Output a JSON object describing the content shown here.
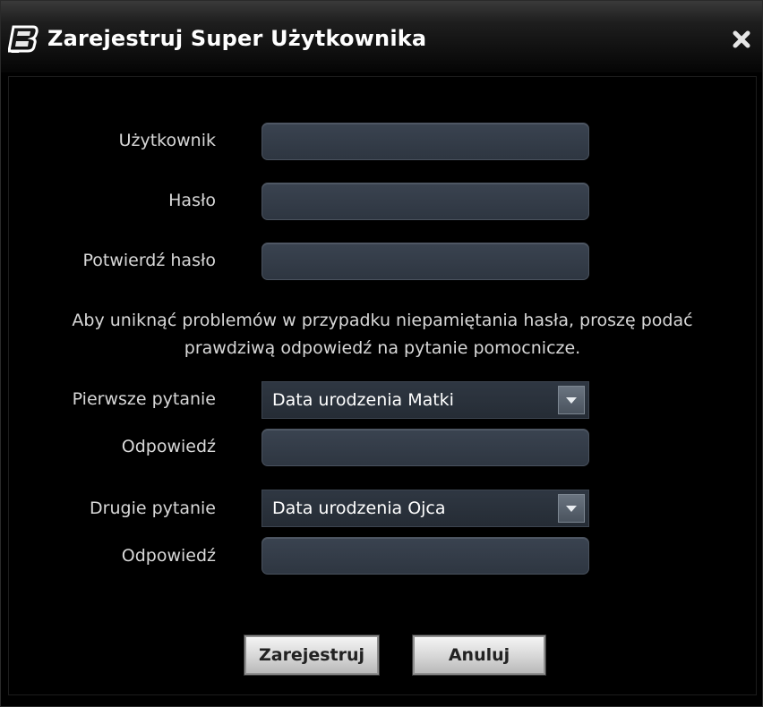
{
  "window": {
    "title": "Zarejestruj Super Użytkownika",
    "logo_icon": "b-logo-icon",
    "close_icon": "close-icon"
  },
  "form": {
    "username_label": "Użytkownik",
    "username_value": "",
    "password_label": "Hasło",
    "password_value": "",
    "confirm_label": "Potwierdź hasło",
    "confirm_value": "",
    "info_line1": "Aby uniknąć problemów w przypadku niepamiętania hasła, proszę podać",
    "info_line2": "prawdziwą odpowiedź na pytanie pomocnicze.",
    "q1_label": "Pierwsze pytanie",
    "q1_value": "Data urodzenia Matki",
    "answer1_label": "Odpowiedź",
    "answer1_value": "",
    "q2_label": "Drugie pytanie",
    "q2_value": "Data urodzenia Ojca",
    "answer2_label": "Odpowiedź",
    "answer2_value": ""
  },
  "buttons": {
    "register_label": "Zarejestruj",
    "cancel_label": "Anuluj"
  },
  "colors": {
    "background": "#000000",
    "field": "#343c47",
    "text": "#d8d8d8"
  }
}
